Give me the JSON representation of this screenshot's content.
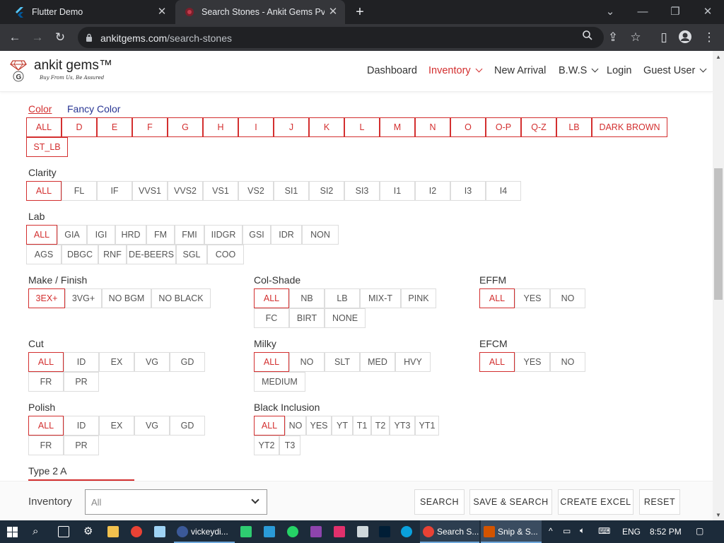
{
  "browser": {
    "tabs": [
      {
        "title": "Flutter Demo",
        "active": false
      },
      {
        "title": "Search Stones - Ankit Gems Pvt. L",
        "active": true
      }
    ],
    "url_domain": "ankitgems.com",
    "url_path": "/search-stones"
  },
  "header": {
    "brand": "ankit gems™",
    "tagline": "Buy From Us, Be Assured",
    "nav": [
      {
        "label": "Dashboard",
        "active": false
      },
      {
        "label": "Inventory",
        "active": true
      },
      {
        "label": "New Arrival",
        "active": false
      },
      {
        "label": "B.W.S",
        "active": false
      },
      {
        "label": "Login",
        "active": false
      },
      {
        "label": "Guest User",
        "active": false
      }
    ]
  },
  "color_tabs": {
    "color": "Color",
    "fancy": "Fancy Color"
  },
  "color_options": [
    "ALL",
    "D",
    "E",
    "F",
    "G",
    "H",
    "I",
    "J",
    "K",
    "L",
    "M",
    "N",
    "O",
    "O-P",
    "Q-Z",
    "LB",
    "DARK BROWN",
    "ST_LB"
  ],
  "clarity": {
    "label": "Clarity",
    "options": [
      "ALL",
      "FL",
      "IF",
      "VVS1",
      "VVS2",
      "VS1",
      "VS2",
      "SI1",
      "SI2",
      "SI3",
      "I1",
      "I2",
      "I3",
      "I4"
    ]
  },
  "lab": {
    "label": "Lab",
    "options": [
      "ALL",
      "GIA",
      "IGI",
      "HRD",
      "FM",
      "FMI",
      "IIDGR",
      "GSI",
      "IDR",
      "NON",
      "AGS",
      "DBGC",
      "RNF",
      "DE-BEERS",
      "SGL",
      "COO"
    ]
  },
  "make": {
    "label": "Make / Finish",
    "options": [
      "3EX+",
      "3VG+",
      "NO BGM",
      "NO BLACK"
    ]
  },
  "colshade": {
    "label": "Col-Shade",
    "options": [
      "ALL",
      "NB",
      "LB",
      "MIX-T",
      "PINK",
      "FC",
      "BIRT",
      "NONE"
    ]
  },
  "effm": {
    "label": "EFFM",
    "options": [
      "ALL",
      "YES",
      "NO"
    ]
  },
  "cut": {
    "label": "Cut",
    "options": [
      "ALL",
      "ID",
      "EX",
      "VG",
      "GD",
      "FR",
      "PR"
    ]
  },
  "milky": {
    "label": "Milky",
    "options": [
      "ALL",
      "NO",
      "SLT",
      "MED",
      "HVY",
      "MEDIUM"
    ]
  },
  "efcm": {
    "label": "EFCM",
    "options": [
      "ALL",
      "YES",
      "NO"
    ]
  },
  "polish": {
    "label": "Polish",
    "options": [
      "ALL",
      "ID",
      "EX",
      "VG",
      "GD",
      "FR",
      "PR"
    ]
  },
  "black": {
    "label": "Black Inclusion",
    "options": [
      "ALL",
      "NO",
      "YES",
      "YT",
      "T1",
      "T2",
      "YT3",
      "YT1",
      "YT2",
      "T3"
    ]
  },
  "type2a": {
    "label": "Type 2 A"
  },
  "bottom": {
    "label": "Inventory",
    "select_value": "All",
    "buttons": [
      "SEARCH",
      "SAVE & SEARCH",
      "CREATE EXCEL",
      "RESET"
    ]
  },
  "taskbar": {
    "items": [
      "vickeydi...",
      "Search S...",
      "Snip & S..."
    ],
    "lang": "ENG",
    "time": "8:52 PM"
  },
  "colors": {
    "accent": "#d32f2f",
    "chip_border": "#dddddd",
    "chrome_dark": "#202124",
    "chrome_bar": "#35363a",
    "taskbar": "#1c2b3a"
  }
}
